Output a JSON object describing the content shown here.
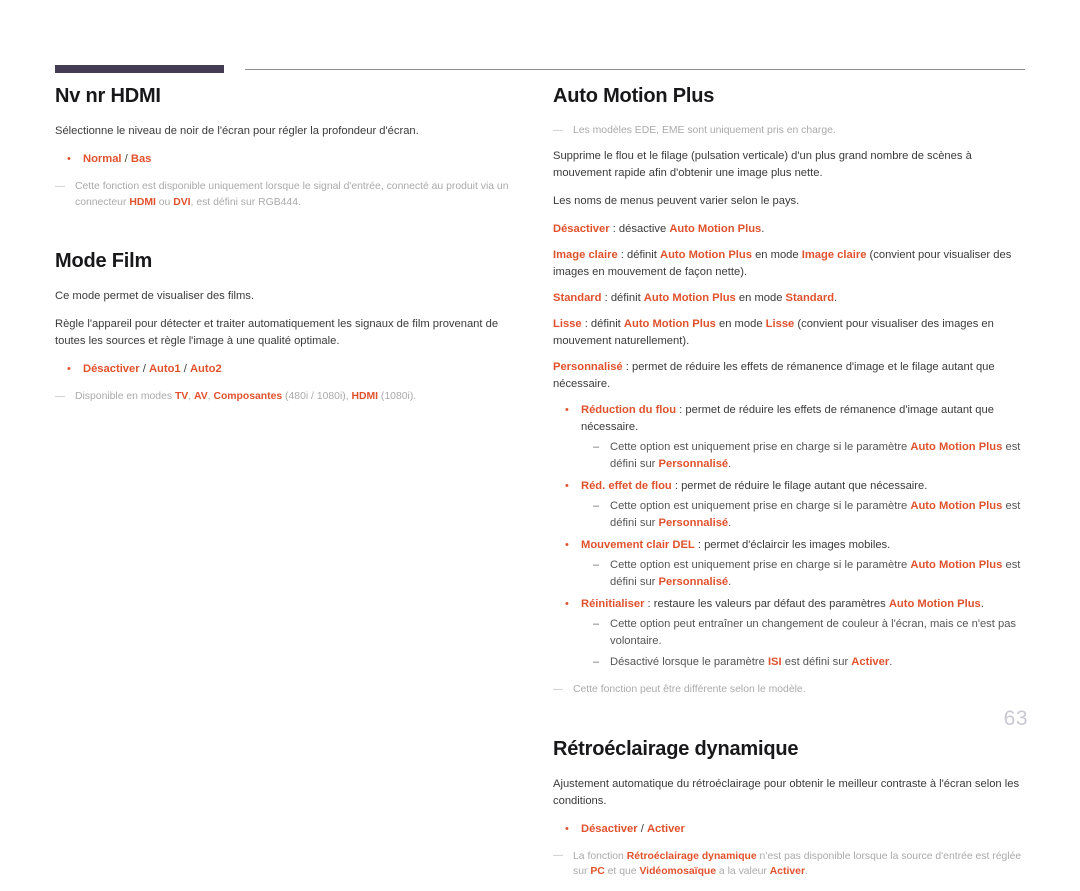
{
  "page": {
    "number": "63"
  },
  "header": {
    "bar_color": "#443c52",
    "line_color": "#8c8c8c"
  },
  "colors": {
    "accent": "#e0522d",
    "heading": "#18181a",
    "body": "#3a3a3a",
    "note": "#aaaaaa",
    "page_number": "#c9c9d2"
  },
  "left_column": {
    "sections": [
      {
        "title": "Nv nr HDMI",
        "intro": "Sélectionne le niveau de noir de l'écran pour régler la profondeur d'écran.",
        "option": {
          "parts": [
            {
              "text": "Normal",
              "style": "accent"
            },
            {
              "text": " / ",
              "style": "plain"
            },
            {
              "text": "Bas",
              "style": "accent"
            }
          ]
        },
        "note": {
          "parts": [
            {
              "text": "Cette fonction est disponible uniquement lorsque le signal d'entrée, connecté au produit via un connecteur ",
              "style": "note"
            },
            {
              "text": "HDMI",
              "style": "note-accent"
            },
            {
              "text": " ou ",
              "style": "note"
            },
            {
              "text": "DVI",
              "style": "note-accent"
            },
            {
              "text": ", est défini sur RGB444.",
              "style": "note"
            }
          ]
        }
      },
      {
        "title": "Mode Film",
        "paragraphs": [
          "Ce mode permet de visualiser des films.",
          "Règle l'appareil pour détecter et traiter automatiquement les signaux de film provenant de toutes les sources et règle l'image à une qualité optimale."
        ],
        "option": {
          "parts": [
            {
              "text": "Désactiver",
              "style": "accent"
            },
            {
              "text": " / ",
              "style": "plain"
            },
            {
              "text": "Auto1",
              "style": "accent"
            },
            {
              "text": " / ",
              "style": "plain"
            },
            {
              "text": "Auto2",
              "style": "accent"
            }
          ]
        },
        "note": {
          "parts": [
            {
              "text": "Disponible en modes ",
              "style": "note"
            },
            {
              "text": "TV",
              "style": "note-accent"
            },
            {
              "text": ", ",
              "style": "note"
            },
            {
              "text": "AV",
              "style": "note-accent"
            },
            {
              "text": ", ",
              "style": "note"
            },
            {
              "text": "Composantes",
              "style": "note-accent"
            },
            {
              "text": " (480i / 1080i), ",
              "style": "note"
            },
            {
              "text": "HDMI",
              "style": "note-accent"
            },
            {
              "text": " (1080i).",
              "style": "note"
            }
          ]
        }
      }
    ]
  },
  "right_column": {
    "auto_motion_plus": {
      "title": "Auto Motion Plus",
      "note_top": "Les modèles EDE, EME sont uniquement pris en charge.",
      "paragraphs": [
        "Supprime le flou et le filage (pulsation verticale) d'un plus grand nombre de scènes à mouvement rapide afin d'obtenir une image plus nette.",
        "Les noms de menus peuvent varier selon le pays."
      ],
      "modes": [
        {
          "parts": [
            {
              "text": "Désactiver",
              "style": "accent"
            },
            {
              "text": " : désactive ",
              "style": "plain"
            },
            {
              "text": "Auto Motion Plus",
              "style": "accent"
            },
            {
              "text": ".",
              "style": "plain"
            }
          ]
        },
        {
          "parts": [
            {
              "text": "Image claire",
              "style": "accent"
            },
            {
              "text": " : définit ",
              "style": "plain"
            },
            {
              "text": "Auto Motion Plus",
              "style": "accent"
            },
            {
              "text": " en mode ",
              "style": "plain"
            },
            {
              "text": "Image claire",
              "style": "accent"
            },
            {
              "text": " (convient pour visualiser des images en mouvement de façon nette).",
              "style": "plain"
            }
          ]
        },
        {
          "parts": [
            {
              "text": "Standard",
              "style": "accent"
            },
            {
              "text": " : définit ",
              "style": "plain"
            },
            {
              "text": "Auto Motion Plus",
              "style": "accent"
            },
            {
              "text": " en mode ",
              "style": "plain"
            },
            {
              "text": "Standard",
              "style": "accent"
            },
            {
              "text": ".",
              "style": "plain"
            }
          ]
        },
        {
          "parts": [
            {
              "text": "Lisse",
              "style": "accent"
            },
            {
              "text": " : définit ",
              "style": "plain"
            },
            {
              "text": "Auto Motion Plus",
              "style": "accent"
            },
            {
              "text": " en mode ",
              "style": "plain"
            },
            {
              "text": "Lisse",
              "style": "accent"
            },
            {
              "text": " (convient pour visualiser des images en mouvement naturellement).",
              "style": "plain"
            }
          ]
        },
        {
          "parts": [
            {
              "text": "Personnalisé",
              "style": "accent"
            },
            {
              "text": " : permet de réduire les effets de rémanence d'image et le filage autant que nécessaire.",
              "style": "plain"
            }
          ]
        }
      ],
      "sub_options": [
        {
          "label": {
            "parts": [
              {
                "text": "Réduction du flou",
                "style": "accent"
              },
              {
                "text": " : permet de réduire les effets de rémanence d'image autant que nécessaire.",
                "style": "plain"
              }
            ]
          },
          "notes": [
            {
              "parts": [
                {
                  "text": "Cette option est uniquement prise en charge si le paramètre ",
                  "style": "plain"
                },
                {
                  "text": "Auto Motion Plus",
                  "style": "accent"
                },
                {
                  "text": " est défini sur ",
                  "style": "plain"
                },
                {
                  "text": "Personnalisé",
                  "style": "accent"
                },
                {
                  "text": ".",
                  "style": "plain"
                }
              ]
            }
          ]
        },
        {
          "label": {
            "parts": [
              {
                "text": "Réd. effet de flou",
                "style": "accent"
              },
              {
                "text": " : permet de réduire le filage autant que nécessaire.",
                "style": "plain"
              }
            ]
          },
          "notes": [
            {
              "parts": [
                {
                  "text": "Cette option est uniquement prise en charge si le paramètre ",
                  "style": "plain"
                },
                {
                  "text": "Auto Motion Plus",
                  "style": "accent"
                },
                {
                  "text": " est défini sur ",
                  "style": "plain"
                },
                {
                  "text": "Personnalisé",
                  "style": "accent"
                },
                {
                  "text": ".",
                  "style": "plain"
                }
              ]
            }
          ]
        },
        {
          "label": {
            "parts": [
              {
                "text": "Mouvement clair DEL",
                "style": "accent"
              },
              {
                "text": " : permet d'éclaircir les images mobiles.",
                "style": "plain"
              }
            ]
          },
          "notes": [
            {
              "parts": [
                {
                  "text": "Cette option est uniquement prise en charge si le paramètre ",
                  "style": "plain"
                },
                {
                  "text": "Auto Motion Plus",
                  "style": "accent"
                },
                {
                  "text": " est défini sur ",
                  "style": "plain"
                },
                {
                  "text": "Personnalisé",
                  "style": "accent"
                },
                {
                  "text": ".",
                  "style": "plain"
                }
              ]
            }
          ]
        },
        {
          "label": {
            "parts": [
              {
                "text": "Réinitialiser",
                "style": "accent"
              },
              {
                "text": " : restaure les valeurs par défaut des paramètres ",
                "style": "plain"
              },
              {
                "text": "Auto Motion Plus",
                "style": "accent"
              },
              {
                "text": ".",
                "style": "plain"
              }
            ]
          },
          "notes": [
            {
              "parts": [
                {
                  "text": "Cette option peut entraîner un changement de couleur à l'écran, mais ce n'est pas volontaire.",
                  "style": "plain"
                }
              ]
            },
            {
              "parts": [
                {
                  "text": "Désactivé lorsque le paramètre ",
                  "style": "plain"
                },
                {
                  "text": "ISI",
                  "style": "accent"
                },
                {
                  "text": " est défini sur ",
                  "style": "plain"
                },
                {
                  "text": "Activer",
                  "style": "accent"
                },
                {
                  "text": ".",
                  "style": "plain"
                }
              ]
            }
          ]
        }
      ],
      "note_bottom": "Cette fonction peut être différente selon le modèle."
    },
    "retroeclairage": {
      "title": "Rétroéclairage dynamique",
      "intro": "Ajustement automatique du rétroéclairage pour obtenir le meilleur contraste à l'écran selon les conditions.",
      "option": {
        "parts": [
          {
            "text": "Désactiver",
            "style": "accent"
          },
          {
            "text": " / ",
            "style": "plain"
          },
          {
            "text": "Activer",
            "style": "accent"
          }
        ]
      },
      "note": {
        "parts": [
          {
            "text": "La fonction ",
            "style": "note"
          },
          {
            "text": "Rétroéclairage dynamique",
            "style": "note-accent"
          },
          {
            "text": " n'est pas disponible lorsque la source d'entrée est réglée sur ",
            "style": "note"
          },
          {
            "text": "PC",
            "style": "note-accent"
          },
          {
            "text": " et que ",
            "style": "note"
          },
          {
            "text": "Vidéomosaïque",
            "style": "note-accent"
          },
          {
            "text": " a la valeur ",
            "style": "note"
          },
          {
            "text": "Activer",
            "style": "note-accent"
          },
          {
            "text": ".",
            "style": "note"
          }
        ]
      }
    }
  }
}
